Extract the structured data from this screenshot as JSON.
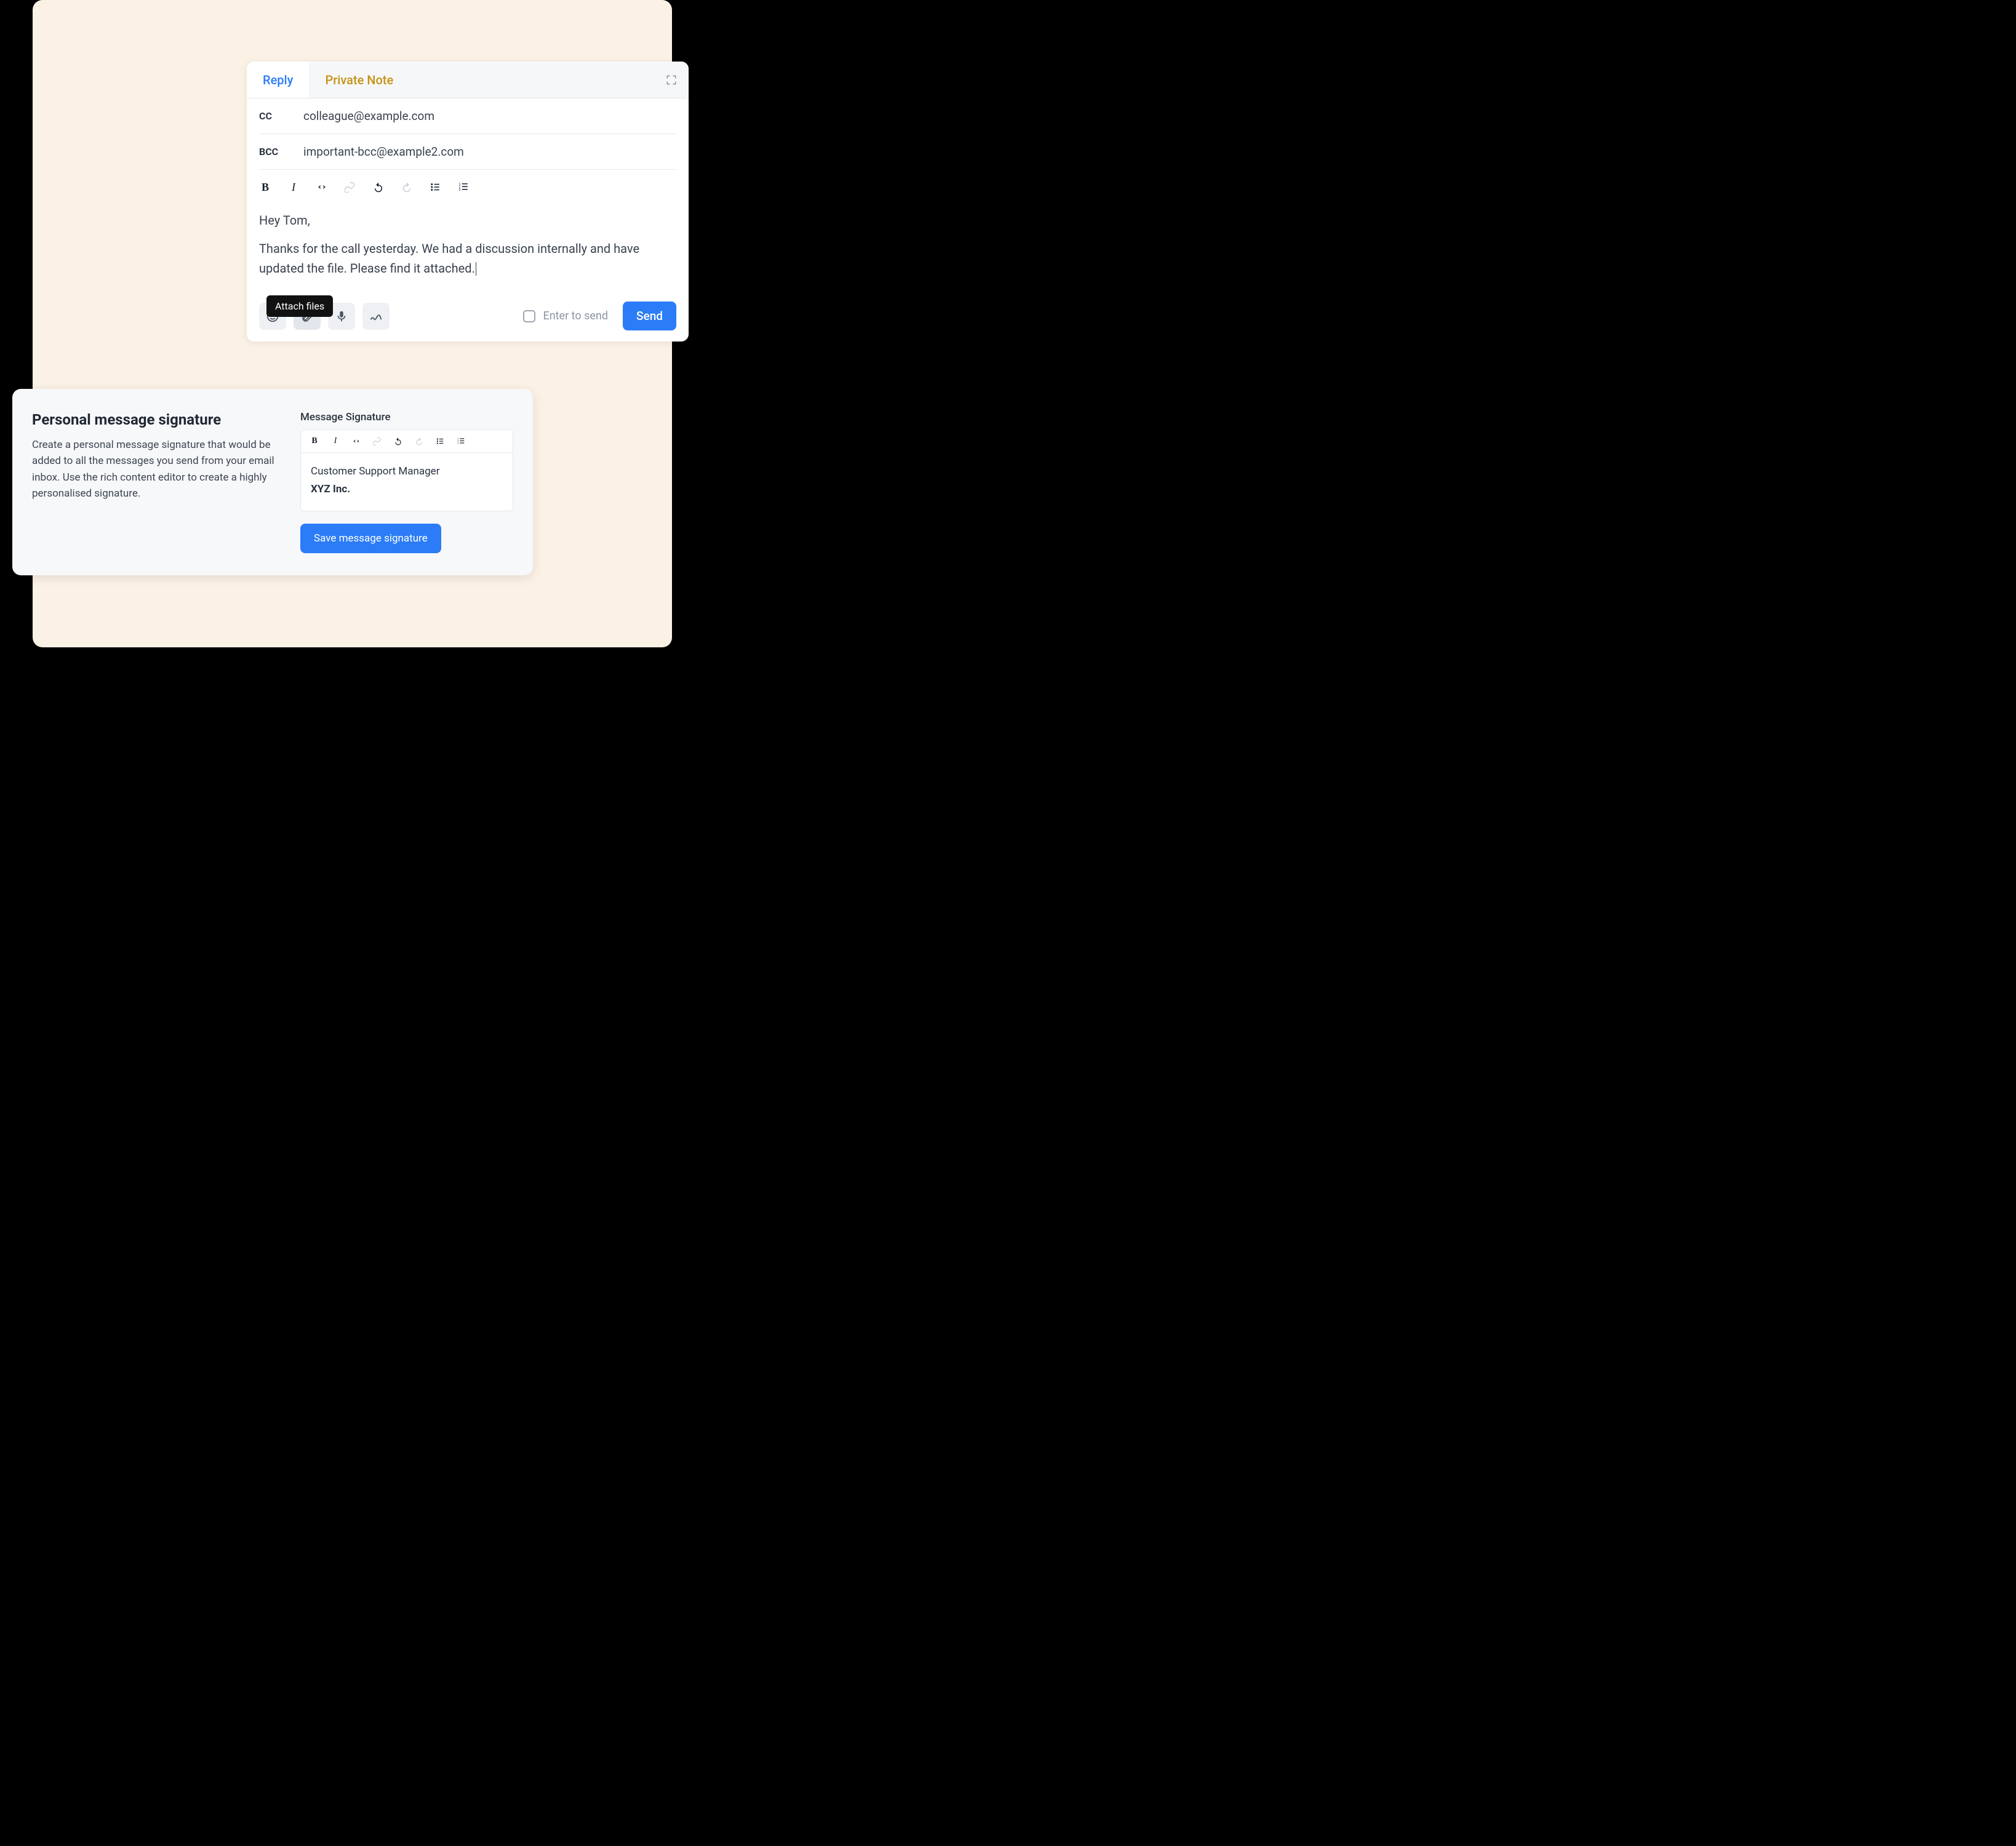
{
  "compose": {
    "tabs": {
      "reply": "Reply",
      "private": "Private Note"
    },
    "cc_label": "CC",
    "cc_value": "colleague@example.com",
    "bcc_label": "BCC",
    "bcc_value": "important-bcc@example2.com",
    "body_greeting": "Hey Tom,",
    "body_para": "Thanks for the call yesterday. We had a discussion internally and have updated the file. Please find it attached.",
    "tooltip_attach": "Attach files",
    "enter_to_send": "Enter to send",
    "send": "Send"
  },
  "signature": {
    "heading": "Personal message signature",
    "description": "Create a personal message signature that would be added to all the messages you send from your email inbox. Use the rich content editor to create a highly personalised signature.",
    "label": "Message Signature",
    "line1": "Customer Support Manager",
    "line2": "XYZ Inc.",
    "save": "Save message signature"
  }
}
